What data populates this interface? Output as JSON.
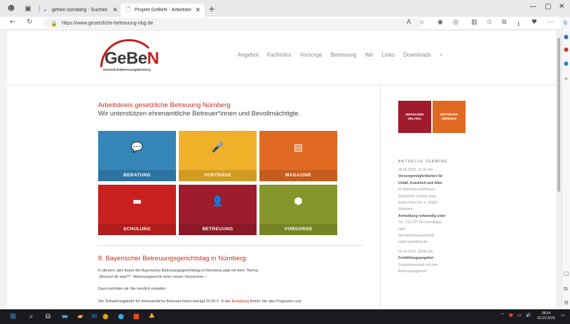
{
  "browser": {
    "tabs": [
      {
        "title": "gehen nürnberg - Suchen",
        "active": false
      },
      {
        "title": "Projekt GeBeN - Arbeitskreis ges",
        "active": true
      }
    ],
    "new_tab_glyph": "+",
    "window_controls": [
      "—",
      "▢",
      "✕"
    ],
    "url": "https://www.gesetzliche-betreuung-nbg.de"
  },
  "site": {
    "logo": {
      "part1": "GeBe",
      "part2": "N",
      "tagline": "GesetzlicheBetreuungNürnberg"
    },
    "nav": [
      "Angebot",
      "Fachinfos",
      "Vorsorge",
      "Betreuung",
      "Wir",
      "Links",
      "Downloads"
    ],
    "intro_title": "Arbeitskreis gesetzliche Betreuung Nürnberg",
    "intro_sub": "Wir unterstützen ehrenamtliche Betreuer*innen und Bevollmächtigte.",
    "tiles": [
      {
        "label": "BERATUNG",
        "icon": "speech-bubble-icon",
        "color": "#3585b8"
      },
      {
        "label": "VORTRÄGE",
        "icon": "lectern-icon",
        "color": "#efb12a"
      },
      {
        "label": "MAGAZINE",
        "icon": "magazine-icon",
        "color": "#e06a22"
      },
      {
        "label": "SCHULUNG",
        "icon": "presentation-icon",
        "color": "#c92020"
      },
      {
        "label": "BETREUUNG",
        "icon": "person-icon",
        "color": "#9e1c2c"
      },
      {
        "label": "VORSORGE",
        "icon": "box-icon",
        "color": "#86962a"
      }
    ],
    "article_title": "8. Bayerischer Betreuungsgerichtstag in Nürnberg",
    "article_lines": [
      "In diesem Jahr findet der Bayerische Betreuungsgerichtstag in Nürnberg statt mit dem Thema:",
      "„Wunsch dir was!?“- Betreuungsrecht unter neuen Vorzeichen –",
      "Dazu möchten wir Sie herzlich einladen.",
      "Die Teilnahmegebühr für ehrenamtliche Betreuer:innen beträgt 20,00 €. In der",
      "Einladung",
      "finden Sie das Programm und"
    ],
    "sidebar": {
      "btn1": "MENSCHEN HELFEN.",
      "btn2": "BETREUER WERDEN!",
      "termine_heading": "AKTUELLE TERMINE",
      "event_lines": [
        {
          "t": "28.09.2023, 15.30 Uhr",
          "b": false
        },
        {
          "t": "Vorsorgemöglichkeiten für",
          "b": true
        },
        {
          "t": "Unfall, Krankheit und Alter",
          "b": true
        },
        {
          "t": "im Nachbarschaftshaus",
          "b": false
        },
        {
          "t": "Gostenhof, Großer Saal",
          "b": false
        },
        {
          "t": "Adam-Klein-Str. 6, 90429",
          "b": false
        },
        {
          "t": "Nürnberg",
          "b": false
        },
        {
          "t": "Anmeldung notwendig unter",
          "b": true
        },
        {
          "t": "Tel.: 231-23778 (vormittags)",
          "b": false
        },
        {
          "t": "oder:",
          "b": false
        },
        {
          "t": "sha-betreuungsstelle@",
          "b": false
        },
        {
          "t": "stadt.nuernberg.de",
          "b": false
        },
        {
          "t": "04.10.2023, 18:00 Uhr",
          "b": false
        },
        {
          "t": "Fortbildungsangebot",
          "b": true
        },
        {
          "t": "Zusammenarbeit mit dem",
          "b": false
        },
        {
          "t": "Betreuungsgericht",
          "b": false
        }
      ]
    }
  },
  "taskbar": {
    "time": "08:54",
    "date": "03.10.2023"
  },
  "colors": {
    "brand_red": "#c6301a",
    "logo_red": "#c41e1e",
    "btn1": "#9e1c2c",
    "btn2": "#e06a22"
  }
}
